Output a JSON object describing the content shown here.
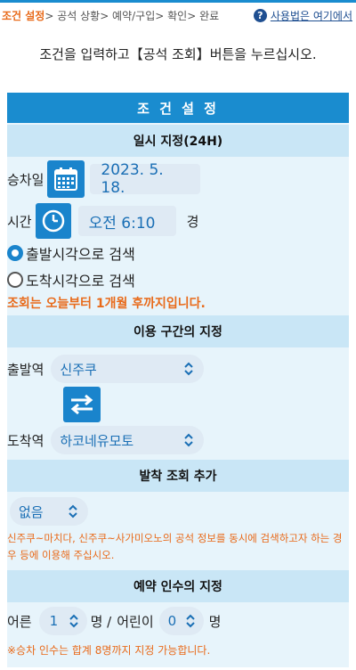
{
  "nav": {
    "step1": "조건 설정",
    "step2": "> 공석 상황> 예약/구입> 확인> 완료",
    "help_label": "사용법은 여기에서",
    "help_glyph": "?"
  },
  "intro_text": "조건을 입력하고【공석 조회】버튼을 누르십시오.",
  "panel": {
    "title": "조 건 설 정",
    "datetime": {
      "heading": "일시 지정(24H)",
      "date_label": "승차일",
      "date_value": "2023. 5. 18.",
      "time_label": "시간",
      "time_value": "오전 6:10",
      "time_suffix": "경",
      "radio_departure": "출발시각으로 검색",
      "radio_arrival": "도착시각으로 검색",
      "radio_selected": "departure",
      "note": "조회는 오늘부터 1개월 후까지입니다."
    },
    "route": {
      "heading": "이용 구간의 지정",
      "from_label": "출발역",
      "from_value": "신주쿠",
      "to_label": "도착역",
      "to_value": "하코네유모토"
    },
    "extra": {
      "heading": "발착 조회 추가",
      "value": "없음",
      "note": "신주쿠~마치다, 신주쿠~사가미오노의 공석 정보를 동시에 검색하고자 하는 경우 등에 이용해 주십시오."
    },
    "passengers": {
      "heading": "예약 인수의 지정",
      "adult_label": "어른",
      "adult_value": "1",
      "adult_unit": "명 /",
      "child_label": "어린이",
      "child_value": "0",
      "child_unit": "명",
      "note": "※승차 인수는 합계 8명까지 지정 가능합니다."
    }
  },
  "colors": {
    "accent": "#1a8ccf",
    "section": "#c9e6f6",
    "panel_bg": "#e7f4fb",
    "warning": "#e86a1a"
  }
}
